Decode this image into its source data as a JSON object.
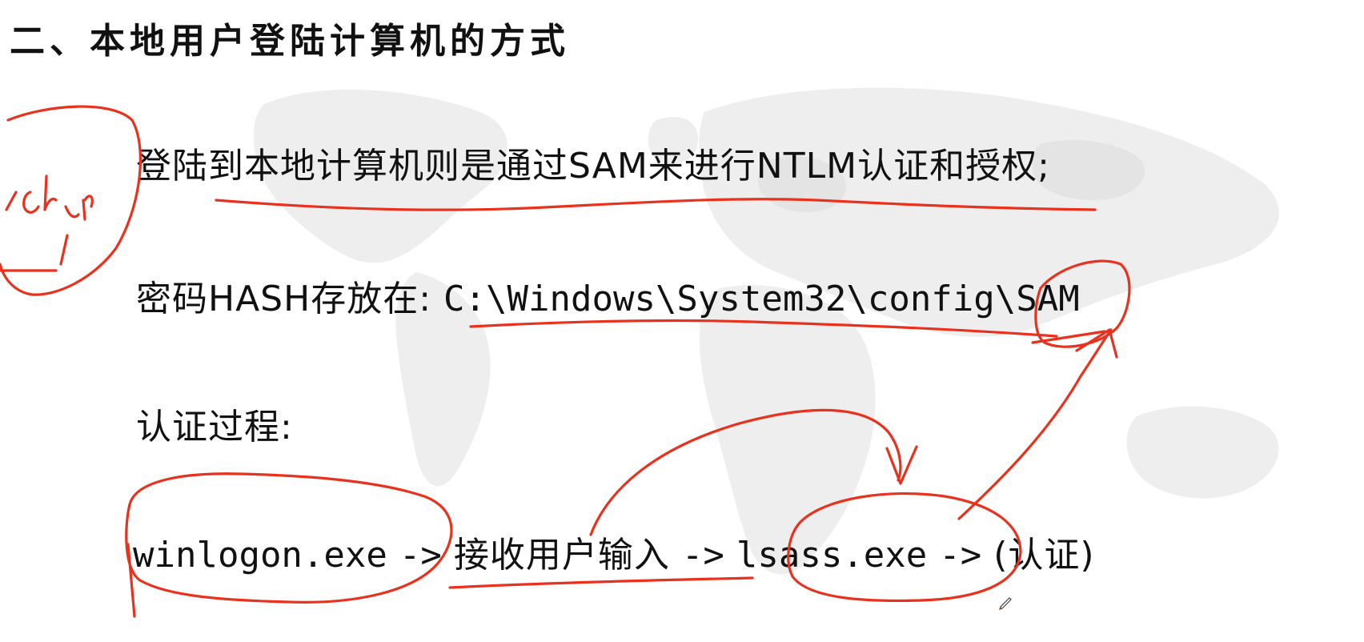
{
  "slide": {
    "title": "二、本地用户登陆计算机的方式",
    "line1": "登陆到本地计算机则是通过SAM来进行NTLM认证和授权;",
    "line2": {
      "label": "密码HASH存放在:",
      "path": "C:\\Windows\\System32\\config\\SAM"
    },
    "line3": "认证过程:",
    "line4": {
      "step1": "winlogon.exe",
      "arrow1": "->",
      "step2": "接收用户输入",
      "arrow2": "->",
      "step3": "lsass.exe",
      "arrow3": "->",
      "step4": "(认证)"
    }
  },
  "icons": {
    "background": "world-map-icon",
    "cursor": "pen-cursor-icon"
  },
  "colors": {
    "annotation": "#e8321e",
    "text": "#111111",
    "map": "#ebebeb"
  }
}
